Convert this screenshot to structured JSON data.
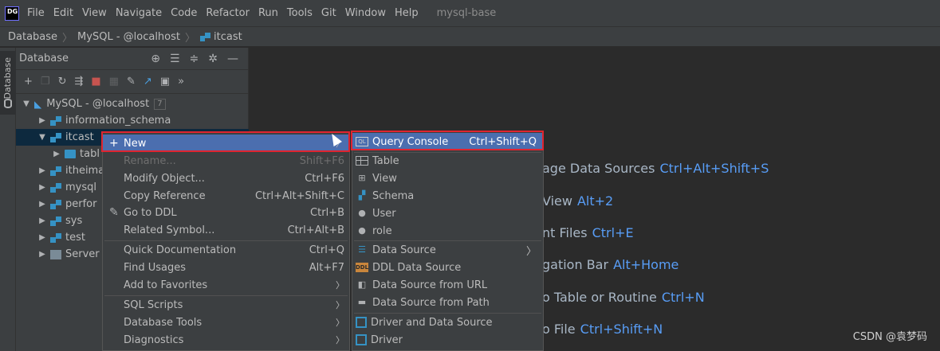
{
  "menubar": {
    "items": [
      "File",
      "Edit",
      "View",
      "Navigate",
      "Code",
      "Refactor",
      "Run",
      "Tools",
      "Git",
      "Window",
      "Help"
    ],
    "project": "mysql-base"
  },
  "breadcrumb": [
    "Database",
    "MySQL - @localhost",
    "itcast"
  ],
  "stripe": {
    "label": "Database"
  },
  "panel": {
    "title": "Database",
    "badge": "7"
  },
  "tree": {
    "root": "MySQL - @localhost",
    "items": [
      "information_schema",
      "itcast",
      "tabl",
      "itheima",
      "mysql",
      "perfor",
      "sys",
      "test",
      "Server"
    ]
  },
  "context_menu": {
    "new": "New",
    "items": [
      {
        "label": "Rename...",
        "shortcut": "Shift+F6"
      },
      {
        "label": "Modify Object...",
        "shortcut": "Ctrl+F6"
      },
      {
        "label": "Copy Reference",
        "shortcut": "Ctrl+Alt+Shift+C"
      },
      {
        "label": "Go to DDL",
        "shortcut": "Ctrl+B"
      },
      {
        "label": "Related Symbol...",
        "shortcut": "Ctrl+Alt+B"
      },
      {
        "label": "Quick Documentation",
        "shortcut": "Ctrl+Q"
      },
      {
        "label": "Find Usages",
        "shortcut": "Alt+F7"
      },
      {
        "label": "Add to Favorites",
        "shortcut": ""
      },
      {
        "label": "SQL Scripts",
        "shortcut": ""
      },
      {
        "label": "Database Tools",
        "shortcut": ""
      },
      {
        "label": "Diagnostics",
        "shortcut": ""
      }
    ]
  },
  "submenu": {
    "items": [
      {
        "label": "Query Console",
        "shortcut": "Ctrl+Shift+Q"
      },
      {
        "label": "Table",
        "shortcut": ""
      },
      {
        "label": "View",
        "shortcut": ""
      },
      {
        "label": "Schema",
        "shortcut": ""
      },
      {
        "label": "User",
        "shortcut": ""
      },
      {
        "label": "role",
        "shortcut": ""
      },
      {
        "label": "Data Source",
        "shortcut": ""
      },
      {
        "label": "DDL Data Source",
        "shortcut": ""
      },
      {
        "label": "Data Source from URL",
        "shortcut": ""
      },
      {
        "label": "Data Source from Path",
        "shortcut": ""
      },
      {
        "label": "Driver and Data Source",
        "shortcut": ""
      },
      {
        "label": "Driver",
        "shortcut": ""
      }
    ]
  },
  "hints": [
    {
      "text": "age Data Sources",
      "key": "Ctrl+Alt+Shift+S"
    },
    {
      "text": "View",
      "key": "Alt+2"
    },
    {
      "text": "nt Files",
      "key": "Ctrl+E"
    },
    {
      "text": "gation Bar",
      "key": "Alt+Home"
    },
    {
      "text": "o Table or Routine",
      "key": "Ctrl+N"
    },
    {
      "text": "o File",
      "key": "Ctrl+Shift+N"
    }
  ],
  "watermark": "CSDN @袁梦码"
}
